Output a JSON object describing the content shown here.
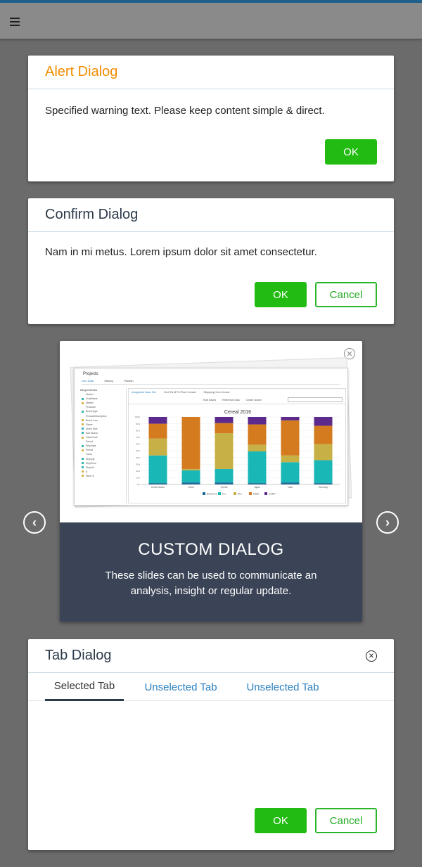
{
  "app": {
    "menu_icon": "hamburger-icon"
  },
  "alert_dialog": {
    "title": "Alert Dialog",
    "message": "Specified warning text. Please keep content simple & direct.",
    "ok_label": "OK"
  },
  "confirm_dialog": {
    "title": "Confirm Dialog",
    "message": "Nam in mi metus. Lorem ipsum dolor sit amet consectetur.",
    "ok_label": "OK",
    "cancel_label": "Cancel"
  },
  "custom_dialog": {
    "heading": "CUSTOM DIALOG",
    "text": "These slides can be used to communicate an analysis, insight or regular update.",
    "close_icon": "close-circle-icon",
    "prev_icon": "chevron-left-circle-icon",
    "next_icon": "chevron-right-circle-icon",
    "preview": {
      "project_label": "Projects",
      "tabs": [
        "Line Data",
        "History",
        "Publish"
      ],
      "sidebar_header": "Merged Metrics",
      "sidebar_items": [
        "Market",
        "CustName",
        "Market",
        "Products",
        "BrandType",
        "ProductDescription",
        "Brand Low",
        "Flavor",
        "Sizen Size",
        "Sub Brand",
        "CaseCode",
        "Period",
        "ShipDate",
        "Period",
        "Facts",
        "ShipQty",
        "ShipPrice",
        "ShipVal",
        "$",
        "Store $"
      ],
      "view_tabs": [
        "Integrated Data Set",
        "XLA TA MTS Pivot Cereal",
        "Shipping XLA Cereal"
      ],
      "tools": [
        "Rule Based",
        "Reference Data",
        "Create Subset"
      ],
      "chart_data": {
        "type": "bar",
        "stacked": true,
        "title": "Cereal 2016",
        "categories": [
          "United States",
          "China",
          "Florida",
          "Japan",
          "India",
          "Germany"
        ],
        "series": [
          {
            "name": "Brand Low",
            "color": "#1a6b9a",
            "values": [
              2,
              3,
              3,
              2,
              3,
              2
            ]
          },
          {
            "name": "FLI",
            "color": "#19b7b5",
            "values": [
              41,
              18,
              20,
              47,
              30,
              34
            ]
          },
          {
            "name": "RCI",
            "color": "#c7b045",
            "values": [
              25,
              2,
              53,
              10,
              10,
              24
            ]
          },
          {
            "name": "KSB2",
            "color": "#d47a1f",
            "values": [
              22,
              77,
              15,
              30,
              52,
              27
            ]
          },
          {
            "name": "CORO",
            "color": "#5b2a8c",
            "values": [
              10,
              0,
              9,
              11,
              5,
              13
            ]
          }
        ],
        "ylim": [
          0,
          100
        ],
        "y_ticks": [
          "0%",
          "10%",
          "20%",
          "30%",
          "40%",
          "50%",
          "60%",
          "70%",
          "80%",
          "90%",
          "100%"
        ],
        "legend_position": "bottom"
      }
    }
  },
  "tab_dialog": {
    "title": "Tab Dialog",
    "close_icon": "close-circle-icon",
    "tabs": [
      {
        "label": "Selected Tab",
        "selected": true
      },
      {
        "label": "Unselected Tab",
        "selected": false
      },
      {
        "label": "Unselected Tab",
        "selected": false
      }
    ],
    "ok_label": "OK",
    "cancel_label": "Cancel"
  },
  "colors": {
    "accent_green": "#22bb11",
    "alert_orange": "#f28c00",
    "tab_blue": "#2a7fc1",
    "footer_dark": "#3b4456"
  }
}
